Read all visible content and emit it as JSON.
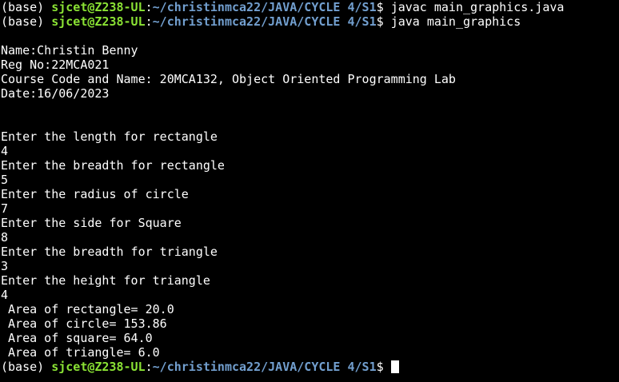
{
  "colors": {
    "background": "#000000",
    "text": "#ffffff",
    "prompt_user": "#8ae234",
    "prompt_path": "#729fcf"
  },
  "prompt": {
    "env": "(base) ",
    "user_host": "sjcet@Z238-UL",
    "colon": ":",
    "path": "~/christinmca22/JAVA/CYCLE 4/S1",
    "symbol": "$ "
  },
  "commands": [
    "javac main_graphics.java",
    "java main_graphics"
  ],
  "output": {
    "header": [
      "Name:Christin Benny",
      "Reg No:22MCA021",
      "Course Code and Name: 20MCA132, Object Oriented Programming Lab",
      "Date:16/06/2023"
    ],
    "interaction": [
      "Enter the length for rectangle",
      "4",
      "Enter the breadth for rectangle",
      "5",
      "Enter the radius of circle",
      "7",
      "Enter the side for Square",
      "8",
      "Enter the breadth for triangle",
      "3",
      "Enter the height for triangle",
      "4"
    ],
    "results": [
      " Area of rectangle= 20.0",
      " Area of circle= 153.86",
      " Area of square= 64.0",
      " Area of triangle= 6.0"
    ]
  }
}
